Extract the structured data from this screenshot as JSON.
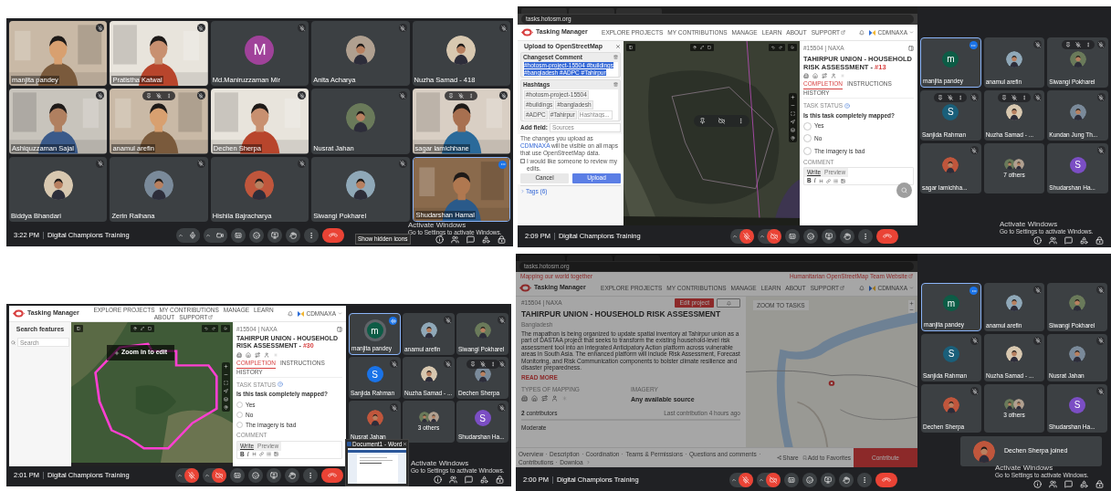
{
  "meetings": [
    {
      "time": "3:22 PM",
      "title": "Digital Champions Training",
      "mic_muted": false,
      "camera_off": false,
      "activation": {
        "title": "Activate Windows",
        "subtitle": "Go to Settings to activate Windows."
      },
      "tooltip": "Show hidden icons",
      "tiles": [
        {
          "name": "manjita pandey",
          "kind": "video",
          "muted": true,
          "hovered": false,
          "active": false,
          "speaking": false
        },
        {
          "name": "Pratistha Katwal",
          "kind": "video",
          "muted": true,
          "hovered": false,
          "active": false,
          "speaking": false
        },
        {
          "name": "Md.Maniruzzaman Mir",
          "kind": "letter",
          "letter": "M",
          "color": "#a0429a",
          "muted": true,
          "hovered": false,
          "active": false,
          "speaking": false
        },
        {
          "name": "Anita Acharya",
          "muted": true,
          "hovered": false,
          "active": false,
          "speaking": false
        },
        {
          "name": "Nuzha Samad - 418",
          "muted": true,
          "hovered": false,
          "active": false,
          "speaking": false
        },
        {
          "name": "Ashiquzzaman Sajal",
          "kind": "video",
          "muted": true,
          "hovered": false,
          "active": false,
          "speaking": false
        },
        {
          "name": "anamul arefin",
          "kind": "video",
          "muted": true,
          "hovered": true,
          "active": false,
          "speaking": false
        },
        {
          "name": "Dechen Sherpa",
          "kind": "video",
          "muted": true,
          "hovered": false,
          "active": false,
          "speaking": false
        },
        {
          "name": "Nusrat Jahan",
          "muted": true,
          "hovered": false,
          "active": false,
          "speaking": false
        },
        {
          "name": "sagar lamichhane",
          "kind": "video",
          "muted": true,
          "hovered": true,
          "active": false,
          "speaking": false
        },
        {
          "name": "Biddya Bhandari",
          "muted": true,
          "hovered": false,
          "active": false,
          "speaking": false
        },
        {
          "name": "Zerin Raihana",
          "muted": true,
          "hovered": false,
          "active": false,
          "speaking": false
        },
        {
          "name": "Hishila Bajracharya",
          "muted": true,
          "hovered": false,
          "active": false,
          "speaking": false
        },
        {
          "name": "Siwangi Pokharel",
          "muted": true,
          "hovered": false,
          "active": false,
          "speaking": false
        },
        {
          "name": "Shudarshan Hamal",
          "kind": "video",
          "muted": false,
          "hovered": false,
          "active": true,
          "speaking": false
        }
      ]
    },
    {
      "time": "2:09 PM",
      "title": "Digital Champions Training",
      "mic_muted": true,
      "camera_off": true,
      "activation": {
        "title": "Activate Windows",
        "subtitle": "Go to Settings to activate Windows."
      },
      "share": {
        "kind": "upload",
        "url": "tasks.hotosm.org",
        "app_name": "Tasking Manager",
        "user": "CDMNAXA",
        "nav": [
          {
            "label": "EXPLORE PROJECTS",
            "external": false
          },
          {
            "label": "MY CONTRIBUTIONS",
            "external": false
          },
          {
            "label": "MANAGE",
            "external": false
          },
          {
            "label": "LEARN",
            "external": false
          },
          {
            "label": "ABOUT",
            "external": false
          },
          {
            "label": "SUPPORT",
            "external": true
          }
        ],
        "dialog": {
          "title": "Upload to OpenStreetMap",
          "comment_label": "Changeset Comment",
          "comment": "#hotosm-project-15504 #buildings #bangladesh #ADPC #Tahirpur",
          "hashtags_label": "Hashtags",
          "hashtags": [
            "#hotosm-project-15504",
            "#buildings",
            "#bangladesh",
            "#ADPC",
            "#Tahirpur"
          ],
          "hashtag_placeholder": "Hashtags...",
          "add_field_label": "Add field:",
          "add_field_placeholder": "Sources",
          "notice": [
            "The changes you upload as",
            "CDMNAXA",
            "will be visible on all maps that use OpenStreetMap data."
          ],
          "review_label": "I would like someone to review my edits.",
          "review_checked": false,
          "cancel": "Cancel",
          "upload": "Upload",
          "tags": "Tags (6)"
        },
        "task": {
          "ref": "#15504 | NAXA",
          "title": "TAHIRPUR UNION - HOUSEHOLD RISK ASSESSMENT - ",
          "number": "#13",
          "tabs": [
            {
              "label": "COMPLETION",
              "selected": true
            },
            {
              "label": "INSTRUCTIONS",
              "selected": false
            },
            {
              "label": "HISTORY",
              "selected": false
            }
          ],
          "status_label": "TASK STATUS",
          "question": "Is this task completely mapped?",
          "options": [
            {
              "label": "Yes",
              "selected": false
            },
            {
              "label": "No",
              "selected": false
            },
            {
              "label": "The imagery is bad",
              "selected": false
            }
          ],
          "comment_label": "COMMENT",
          "comment_tabs": [
            {
              "label": "Write",
              "selected": true
            },
            {
              "label": "Preview",
              "selected": false
            }
          ],
          "format_buttons": [
            "B",
            "I"
          ]
        }
      },
      "tiles": [
        {
          "name": "manjita pandey",
          "kind": "letter",
          "letter": "m",
          "color": "#0d5c46",
          "muted": false,
          "hovered": false,
          "active": true,
          "speaking": false
        },
        {
          "name": "anamul arefin",
          "muted": true,
          "hovered": false,
          "active": false,
          "speaking": false
        },
        {
          "name": "Siwangi Pokharel",
          "muted": true,
          "hovered": true,
          "active": false,
          "speaking": false
        },
        {
          "name": "Sanjida Rahman",
          "kind": "letter",
          "letter": "S",
          "color": "#1a5f7a",
          "muted": true,
          "hovered": true,
          "active": false,
          "speaking": false
        },
        {
          "name": "Nuzha Samad - ...",
          "muted": true,
          "hovered": true,
          "active": false,
          "speaking": false
        },
        {
          "name": "Kundan Jung Th...",
          "muted": true,
          "hovered": false,
          "active": false,
          "speaking": false
        },
        {
          "name": "sagar lamichha...",
          "muted": true,
          "hovered": false,
          "active": false,
          "speaking": false
        },
        {
          "name": "7 others",
          "kind": "others",
          "muted": false,
          "hovered": false,
          "active": false,
          "speaking": false
        },
        {
          "name": "Shudarshan Ha...",
          "kind": "letter",
          "letter": "S",
          "color": "#7b4ec4",
          "muted": true,
          "hovered": false,
          "active": false,
          "speaking": false
        }
      ]
    },
    {
      "time": "2:01 PM",
      "title": "Digital Champions Training",
      "mic_muted": true,
      "camera_off": true,
      "activation": {
        "title": "Activate Windows",
        "subtitle": "Go to Settings to activate Windows."
      },
      "popup": {
        "title": "Document1 - Word"
      },
      "share": {
        "kind": "task",
        "app_name": "Tasking Manager",
        "user": "CDMNAXA",
        "nav": [
          {
            "label": "EXPLORE PROJECTS",
            "external": false
          },
          {
            "label": "MY CONTRIBUTIONS",
            "external": false
          },
          {
            "label": "MANAGE",
            "external": false
          },
          {
            "label": "LEARN",
            "external": false
          },
          {
            "label": "ABOUT",
            "external": false
          },
          {
            "label": "SUPPORT",
            "external": true
          }
        ],
        "search_title": "Search features",
        "search_placeholder": "Search",
        "zoom_hint": "Zoom in to edit",
        "task": {
          "ref": "#15504 | NAXA",
          "title": "TAHIRPUR UNION - HOUSEHOLD RISK ASSESSMENT - ",
          "number": "#30",
          "tabs": [
            {
              "label": "COMPLETION",
              "selected": true
            },
            {
              "label": "INSTRUCTIONS",
              "selected": false
            },
            {
              "label": "HISTORY",
              "selected": false
            }
          ],
          "status_label": "TASK STATUS",
          "question": "Is this task completely mapped?",
          "options": [
            {
              "label": "Yes",
              "selected": false
            },
            {
              "label": "No",
              "selected": false
            },
            {
              "label": "The imagery is bad",
              "selected": false
            }
          ],
          "comment_label": "COMMENT",
          "comment_tabs": [
            {
              "label": "Write",
              "selected": true
            },
            {
              "label": "Preview",
              "selected": false
            }
          ],
          "format_buttons": [
            "B",
            "I"
          ]
        }
      },
      "tiles": [
        {
          "name": "manjita pandey",
          "kind": "letter",
          "letter": "m",
          "color": "#0d5c46",
          "muted": false,
          "hovered": false,
          "active": true,
          "speaking": true
        },
        {
          "name": "anamul arefin",
          "muted": true,
          "hovered": false,
          "active": false,
          "speaking": false
        },
        {
          "name": "Siwangi Pokharel",
          "muted": true,
          "hovered": false,
          "active": false,
          "speaking": false
        },
        {
          "name": "Sanjida Rahman",
          "kind": "letter",
          "letter": "S",
          "color": "#1a73e8",
          "muted": true,
          "hovered": false,
          "active": false,
          "speaking": false
        },
        {
          "name": "Nuzha Samad - ...",
          "muted": true,
          "hovered": false,
          "active": false,
          "speaking": false
        },
        {
          "name": "Dechen Sherpa",
          "muted": true,
          "hovered": true,
          "active": false,
          "speaking": false
        },
        {
          "name": "Nusrat Jahan",
          "muted": true,
          "hovered": false,
          "active": false,
          "speaking": false
        },
        {
          "name": "3 others",
          "kind": "others",
          "muted": false,
          "hovered": false,
          "active": false,
          "speaking": false
        },
        {
          "name": "Shudarshan Ha...",
          "kind": "letter",
          "letter": "S",
          "color": "#7b4ec4",
          "muted": true,
          "hovered": false,
          "active": false,
          "speaking": false
        }
      ]
    },
    {
      "time": "2:00 PM",
      "title": "Digital Champions Training",
      "mic_muted": true,
      "camera_off": true,
      "dimmed": true,
      "activation": {
        "title": "Activate Windows",
        "subtitle": "Go to Settings to activate Windows."
      },
      "toast": "Dechen Sherpa joined",
      "share": {
        "kind": "project",
        "url": "tasks.hotosm.org",
        "tagline": "Mapping our world together",
        "hot_link": "Humanitarian OpenStreetMap Team Website",
        "app_name": "Tasking Manager",
        "user": "CDMNAXA",
        "nav": [
          {
            "label": "EXPLORE PROJECTS",
            "external": false
          },
          {
            "label": "MY CONTRIBUTIONS",
            "external": false
          },
          {
            "label": "MANAGE",
            "external": false
          },
          {
            "label": "LEARN",
            "external": false
          },
          {
            "label": "ABOUT",
            "external": false
          },
          {
            "label": "SUPPORT",
            "external": true
          }
        ],
        "ref": "#15504 | NAXA",
        "edit_button": "Edit project",
        "title": "TAHIRPUR UNION - HOUSEHOLD RISK ASSESSMENT",
        "country": "Bangladesh",
        "description": "The mapathon is being organized to update spatial inventory at Tahirpur union as a part of DASTAA project that seeks to transform the existing household-level risk assessment tool into an integrated Anticipatory Action platform across vulnerable areas in South Asia. The enhanced platform will include Risk Assessment, Forecast Monitoring, and Risk Communication components to bolster climate resilience and disaster preparedness.",
        "read_more": "READ MORE",
        "mapping_label": "TYPES OF MAPPING",
        "imagery_label": "IMAGERY",
        "imagery": "Any available source",
        "contributors": "**2** contributors",
        "last_contribution": "Last contribution 4 hours ago",
        "difficulty": "Moderate",
        "zoom_button": "ZOOM TO TASKS",
        "sections": [
          "Overview",
          "Description",
          "Coordination",
          "Teams & Permissions",
          "Questions and comments",
          "Contributions",
          "Downloa"
        ],
        "share_label": "Share",
        "favorite_label": "Add to Favorites",
        "contribute": "Contribute"
      },
      "tiles": [
        {
          "name": "manjita pandey",
          "kind": "letter",
          "letter": "m",
          "color": "#0d5c46",
          "muted": false,
          "hovered": false,
          "active": true,
          "speaking": false
        },
        {
          "name": "anamul arefin",
          "muted": true,
          "hovered": false,
          "active": false,
          "speaking": false
        },
        {
          "name": "Siwangi Pokharel",
          "muted": true,
          "hovered": false,
          "active": false,
          "speaking": false
        },
        {
          "name": "Sanjida Rahman",
          "kind": "letter",
          "letter": "S",
          "color": "#1a5f7a",
          "muted": true,
          "hovered": false,
          "active": false,
          "speaking": false
        },
        {
          "name": "Nuzha Samad - ...",
          "muted": true,
          "hovered": false,
          "active": false,
          "speaking": false
        },
        {
          "name": "Nusrat Jahan",
          "muted": true,
          "hovered": false,
          "active": false,
          "speaking": false
        },
        {
          "name": "Dechen Sherpa",
          "muted": true,
          "hovered": false,
          "active": false,
          "speaking": false
        },
        {
          "name": "3 others",
          "kind": "others",
          "muted": false,
          "hovered": false,
          "active": false,
          "speaking": false
        },
        {
          "name": "Shudarshan Ha...",
          "kind": "letter",
          "letter": "S",
          "color": "#7b4ec4",
          "muted": true,
          "hovered": false,
          "active": false,
          "speaking": false
        }
      ]
    }
  ]
}
